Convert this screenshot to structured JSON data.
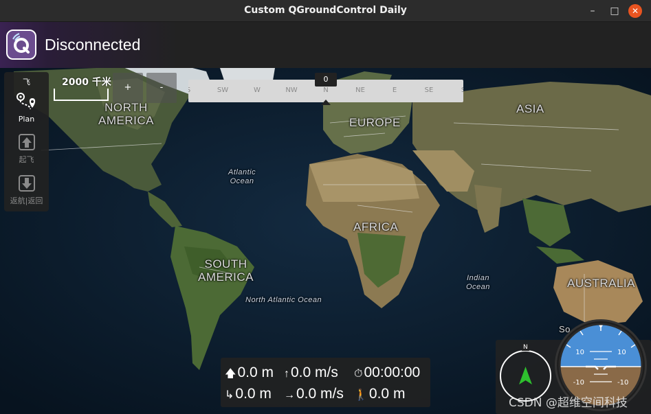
{
  "window": {
    "title": "Custom QGroundControl Daily",
    "min_icon": "minimize-icon",
    "max_icon": "maximize-icon",
    "close_icon": "close-icon"
  },
  "toolbar": {
    "status": "Disconnected"
  },
  "toolstrip": {
    "items": [
      {
        "label": "飞",
        "icon": "fly-icon"
      },
      {
        "label": "Plan",
        "icon": "plan-icon"
      },
      {
        "label": "起飞",
        "icon": "takeoff-icon"
      },
      {
        "label": "返航|返回",
        "icon": "return-icon"
      }
    ]
  },
  "map": {
    "scale_text": "2000 千米",
    "zoom_in": "+",
    "zoom_out": "-",
    "continents": {
      "north_america": "NORTH\nAMERICA",
      "south_america": "SOUTH\nAMERICA",
      "europe": "EUROPE",
      "africa": "AFRICA",
      "asia": "ASIA",
      "australia": "AUSTRALIA",
      "south_partial": "So"
    },
    "oceans": {
      "atlantic": "Atlantic\nOcean",
      "north_atlantic": "North Atlantic Ocean",
      "indian": "Indian\nOcean"
    }
  },
  "heading": {
    "value": "0",
    "directions": [
      "S",
      "SW",
      "W",
      "NW",
      "N",
      "NE",
      "E",
      "SE",
      "S"
    ]
  },
  "telemetry": {
    "altitude": "0.0 m",
    "vertical_speed": "0.0 m/s",
    "flight_time": "00:00:00",
    "distance": "0.0 m",
    "ground_speed": "0.0 m/s",
    "home_distance": "0.0 m"
  },
  "compass": {
    "north_label": "N"
  },
  "attitude": {
    "pitch_labels": [
      "10",
      "10",
      "-10",
      "-10"
    ]
  },
  "watermark": "CSDN @超维空间科技",
  "colors": {
    "accent": "#6b4c8e",
    "close": "#e95420",
    "sky": "#4a8fd6",
    "ground": "#8a6a48",
    "arrow": "#2ec02e"
  }
}
